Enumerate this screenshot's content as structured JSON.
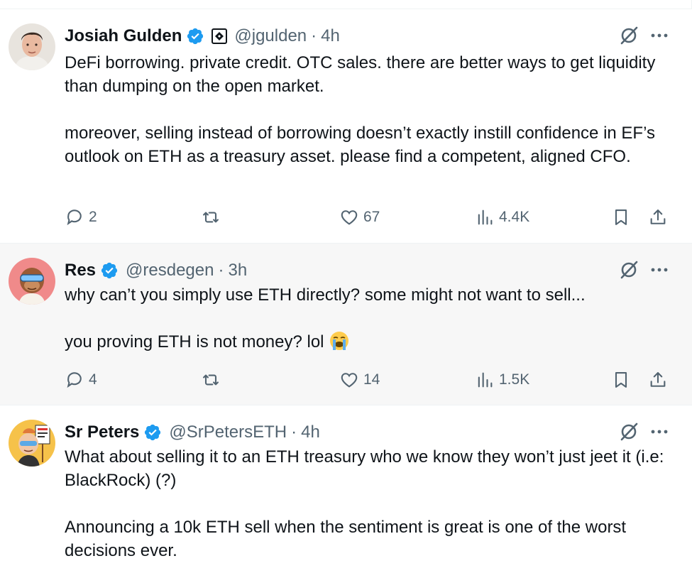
{
  "colors": {
    "verified": "#1d9bf0",
    "text": "#0f1419",
    "muted": "#536471",
    "highlight_bg": "#f7f7f7"
  },
  "tweets": [
    {
      "name": "Josiah Gulden",
      "handle": "@jgulden",
      "separator": "·",
      "time": "4h",
      "verified": true,
      "affiliate_badge": true,
      "avatar_icon": "avatar-man-photo",
      "paragraphs": [
        "DeFi borrowing. private credit. OTC sales. there are better ways to get liquidity than dumping on the open market.",
        "moreover, selling instead of borrowing doesn’t exactly instill confidence in EF’s outlook on ETH as a treasury asset. please find a competent, aligned CFO."
      ],
      "replies": "2",
      "retweets": "",
      "likes": "67",
      "views": "4.4K"
    },
    {
      "name": "Res",
      "handle": "@resdegen",
      "separator": "·",
      "time": "3h",
      "verified": true,
      "avatar_icon": "avatar-ape-nft",
      "paragraphs": [
        "why can’t you simply use ETH directly? some might not want to sell...",
        "you proving ETH is not money? lol"
      ],
      "emoji": "loudly-crying-face-emoji",
      "replies": "4",
      "retweets": "",
      "likes": "14",
      "views": "1.5K"
    },
    {
      "name": "Sr Peters",
      "handle": "@SrPetersETH",
      "separator": "·",
      "time": "4h",
      "verified": true,
      "avatar_icon": "avatar-cartoon-sign",
      "paragraphs": [
        "What about selling it to an ETH treasury who we know they won’t just jeet it (i.e: BlackRock) (?)",
        "Announcing a 10k ETH sell when the sentiment is great is one of the worst decisions ever."
      ]
    }
  ]
}
